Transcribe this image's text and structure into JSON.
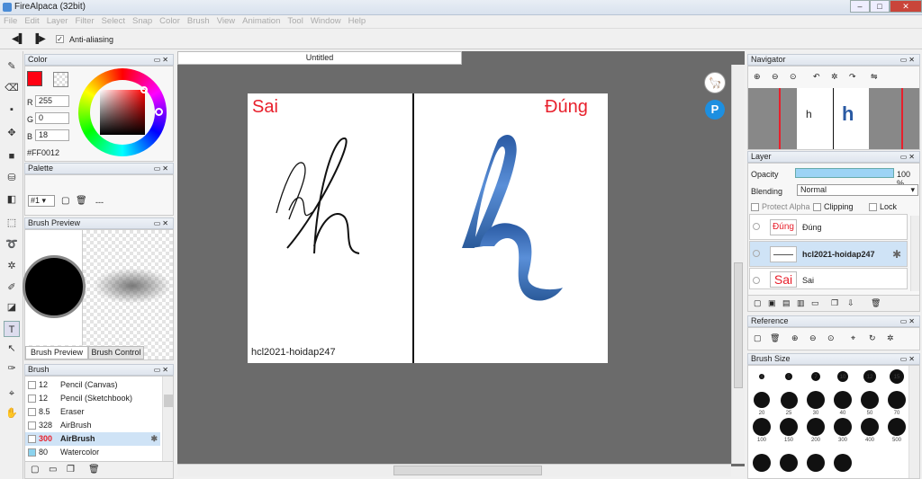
{
  "window": {
    "title": "FireAlpaca (32bit)"
  },
  "menu": [
    "File",
    "Edit",
    "Layer",
    "Filter",
    "Select",
    "Snap",
    "Color",
    "Brush",
    "View",
    "Animation",
    "Tool",
    "Window",
    "Help"
  ],
  "toolbar": {
    "antialias_label": "Anti-aliasing",
    "antialias_checked": true
  },
  "color_panel": {
    "title": "Color",
    "r_label": "R",
    "r": "255",
    "g_label": "G",
    "g": "0",
    "b_label": "B",
    "b": "18",
    "hex": "#FF0012",
    "fg": "#FF0012"
  },
  "palette_panel": {
    "title": "Palette",
    "selector": "#1",
    "dots": "---"
  },
  "brush_preview_panel": {
    "title": "Brush Preview",
    "tab1": "Brush Preview",
    "tab2": "Brush Control"
  },
  "brush_panel": {
    "title": "Brush",
    "items": [
      {
        "size": "12",
        "name": "Pencil (Canvas)"
      },
      {
        "size": "12",
        "name": "Pencil (Sketchbook)"
      },
      {
        "size": "8.5",
        "name": "Eraser"
      },
      {
        "size": "328",
        "name": "AirBrush"
      },
      {
        "size": "300",
        "name": "AirBrush"
      },
      {
        "size": "80",
        "name": "Watercolor"
      }
    ]
  },
  "document": {
    "tab": "Untitled",
    "left_title": "Sai",
    "right_title": "Đúng",
    "watermark": "hcl2021-hoidap247",
    "title_color": "#e8202c"
  },
  "navigator": {
    "title": "Navigator"
  },
  "layer_panel": {
    "title": "Layer",
    "opacity_label": "Opacity",
    "opacity_value": "100 %",
    "opacity": 1.0,
    "blending_label": "Blending",
    "blending_value": "Normal",
    "protect_alpha": "Protect Alpha",
    "clipping": "Clipping",
    "lock": "Lock",
    "layers": [
      {
        "name": "Đúng",
        "thumb": "Đúng"
      },
      {
        "name": "hcl2021-hoidap247",
        "thumb": ""
      },
      {
        "name": "Sai",
        "thumb": "Sai"
      }
    ]
  },
  "reference_panel": {
    "title": "Reference"
  },
  "brush_size_panel": {
    "title": "Brush Size",
    "row1": [
      "4",
      "5",
      "7",
      "10",
      "12",
      "15"
    ],
    "row2": [
      "20",
      "25",
      "30",
      "40",
      "50",
      "70"
    ],
    "row3": [
      "100",
      "150",
      "200",
      "300",
      "400",
      "500"
    ]
  }
}
